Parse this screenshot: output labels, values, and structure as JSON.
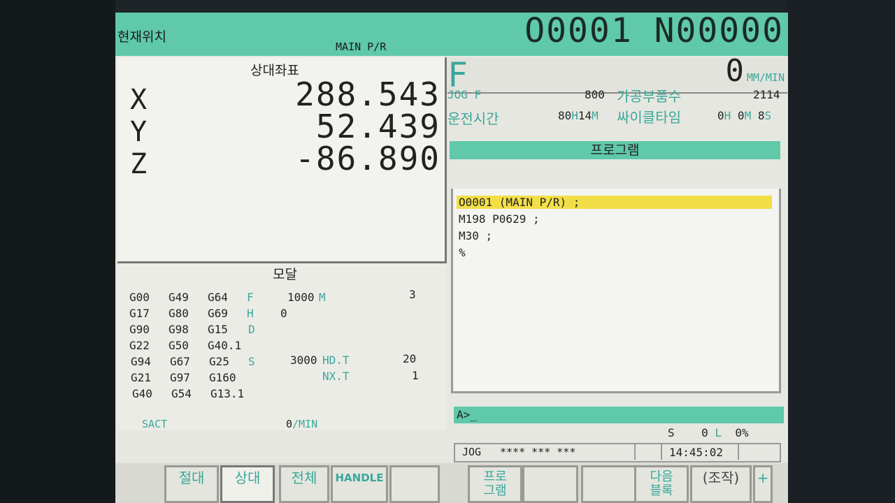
{
  "header": {
    "screen_title": "현재위치",
    "sub_title": "MAIN P/R",
    "program_number": "O0001 N00000"
  },
  "position": {
    "heading": "상대좌표",
    "axes": [
      {
        "label": "X",
        "value": "288.543"
      },
      {
        "label": "Y",
        "value": "52.439"
      },
      {
        "label": "Z",
        "value": "-86.890"
      }
    ]
  },
  "feed": {
    "letter": "F",
    "value": "0",
    "unit": "MM/MIN",
    "jog_f_label": "JOG F",
    "jog_f_value": "800",
    "parts_label": "가공부품수",
    "parts_value": "2114",
    "run_time_label": "운전시간",
    "run_time_hours": "80",
    "run_time_h_unit": "H",
    "run_time_minutes": "14",
    "run_time_m_unit": "M",
    "cycle_time_label": "싸이클타임",
    "cycle_time_h": "0",
    "cycle_time_m": "0",
    "cycle_time_s": "8",
    "unit_h": "H",
    "unit_m": "M",
    "unit_s": "S"
  },
  "program": {
    "heading": "프로그램",
    "lines": [
      "O0001 (MAIN P/R) ;",
      "M198 P0629 ;",
      "M30 ;",
      "%"
    ]
  },
  "modal": {
    "heading": "모달",
    "rows": [
      [
        "G00",
        "G49",
        "G64"
      ],
      [
        "G17",
        "G80",
        "G69"
      ],
      [
        "G90",
        "G98",
        "G15"
      ],
      [
        "G22",
        "G50",
        "G40.1"
      ],
      [
        "G94",
        "G67",
        "G25"
      ],
      [
        "G21",
        "G97",
        "G160"
      ],
      [
        "G40",
        "G54",
        "G13.1"
      ]
    ],
    "f_label": "F",
    "f_value": "1000",
    "m_label": "M",
    "m_value": "3",
    "h_label": "H",
    "h_value": "0",
    "d_label": "D",
    "s_label": "S",
    "s_value": "3000",
    "hdt_label": "HD.T",
    "hdt_value": "20",
    "nxt_label": "NX.T",
    "nxt_value": "1",
    "sact_label": "SACT",
    "sact_value": "0",
    "sact_unit": "/MIN"
  },
  "input_prompt": "A>_",
  "spindle": {
    "s_label": "S",
    "s_value": "0",
    "l_label": "L",
    "load": "0%"
  },
  "status": {
    "mode": "JOG",
    "flags": "**** *** ***",
    "time": "14:45:02"
  },
  "soft_keys": [
    {
      "label": "절대",
      "active": false
    },
    {
      "label": "상대",
      "active": true
    },
    {
      "label": "전체",
      "active": false
    },
    {
      "label": "HANDLE",
      "active": false
    },
    {
      "label": "",
      "active": false
    },
    {
      "label": "프로\n그램",
      "active": false
    },
    {
      "label": "",
      "active": false
    },
    {
      "label": "",
      "active": false
    },
    {
      "label": "다음\n블록",
      "active": false
    },
    {
      "label": "(조작)",
      "active": false
    },
    {
      "label": "+",
      "active": false
    }
  ]
}
